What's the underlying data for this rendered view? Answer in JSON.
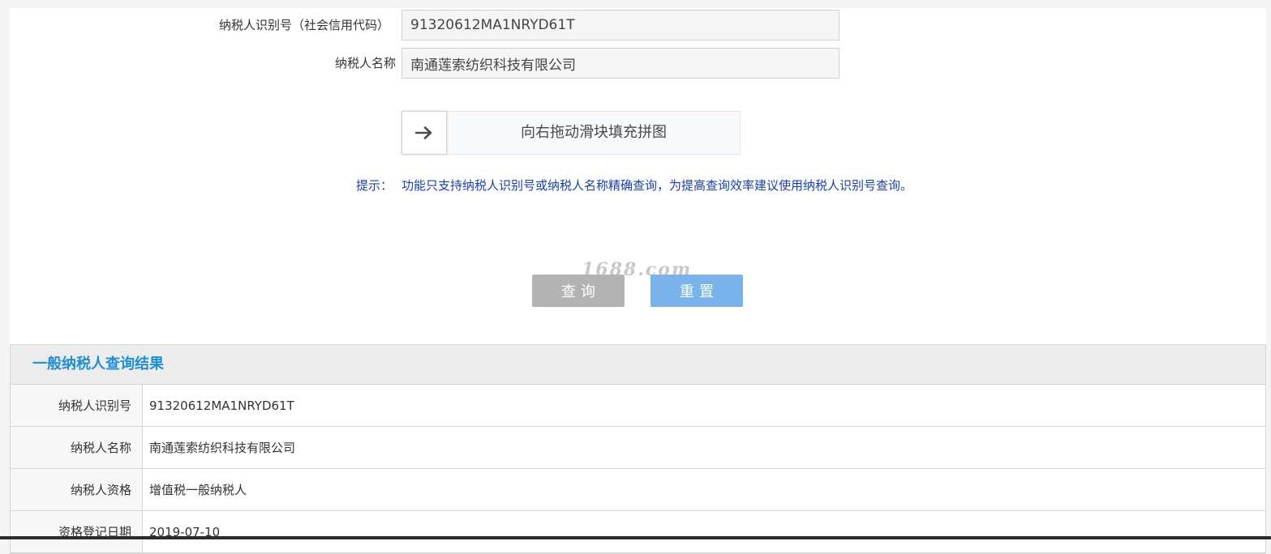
{
  "form": {
    "taxpayer_id_label": "纳税人识别号（社会信用代码）",
    "taxpayer_id_value": "91320612MA1NRYD61T",
    "taxpayer_name_label": "纳税人名称",
    "taxpayer_name_value": "南通莲索纺织科技有限公司"
  },
  "slider": {
    "text": "向右拖动滑块填充拼图",
    "handle_icon": "arrow-right-icon",
    "progress": 0
  },
  "hint": {
    "label": "提示：",
    "text": "功能只支持纳税人识别号或纳税人名称精确查询，为提高查询效率建议使用纳税人识别号查询。"
  },
  "watermark": "1688.com",
  "buttons": {
    "query_label": "查询",
    "reset_label": "重置"
  },
  "result": {
    "title": "一般纳税人查询结果",
    "rows": [
      {
        "key": "纳税人识别号",
        "value": "91320612MA1NRYD61T"
      },
      {
        "key": "纳税人名称",
        "value": "南通莲索纺织科技有限公司"
      },
      {
        "key": "纳税人资格",
        "value": "增值税一般纳税人"
      },
      {
        "key": "资格登记日期",
        "value": "2019-07-10"
      }
    ]
  },
  "colors": {
    "hint_text": "#1a3fa8",
    "result_title": "#1e8fd3",
    "query_button": "#b3b3b3",
    "reset_button": "#7ab3ea"
  }
}
